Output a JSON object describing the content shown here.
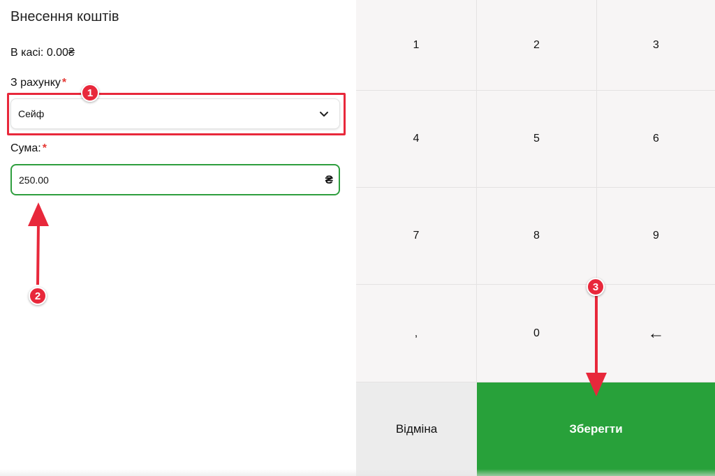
{
  "form": {
    "title": "Внесення коштів",
    "balance_label": "В касі: 0.00₴",
    "account_label": "З рахунку",
    "account_required": "*",
    "account_value": "Сейф",
    "sum_label": "Сума:",
    "sum_required": "*",
    "sum_value": "250.00",
    "currency_symbol": "₴"
  },
  "keypad": {
    "keys": [
      "1",
      "2",
      "3",
      "4",
      "5",
      "6",
      "7",
      "8",
      "9",
      ",",
      "0",
      "←"
    ]
  },
  "actions": {
    "cancel_label": "Відміна",
    "save_label": "Зберегти"
  },
  "annotations": {
    "badges": [
      "1",
      "2",
      "3"
    ],
    "color": "#e8283b"
  },
  "colors": {
    "accent_green": "#28a13a",
    "input_border_green": "#2e9e3e",
    "keypad_bg": "#f7f5f5"
  }
}
